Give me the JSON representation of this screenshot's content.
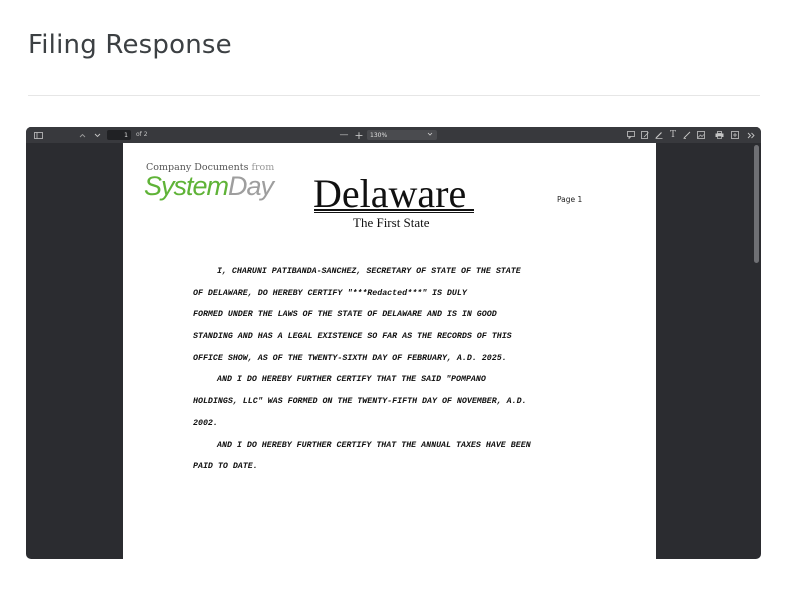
{
  "page": {
    "title": "Filing Response"
  },
  "viewer": {
    "toolbar": {
      "page_current": "1",
      "page_total_label": "of 2",
      "zoom_value": "130%",
      "zoom_minus": "—",
      "zoom_plus": "+",
      "icons": [
        "sidebar-toggle-icon",
        "chevron-up-icon",
        "chevron-down-icon",
        "comment-icon",
        "edit-icon",
        "highlight-icon",
        "text-icon",
        "draw-icon",
        "image-icon",
        "print-icon",
        "save-icon",
        "more-tools-icon"
      ]
    },
    "document": {
      "logo_line1": "Company Documents",
      "logo_line1_suffix": "from",
      "logo_system": "System",
      "logo_day": "Day",
      "state_name": "Delaware",
      "state_motto": "The First State",
      "page_label": "Page 1",
      "lines": [
        "I, CHARUNI PATIBANDA-SANCHEZ, SECRETARY OF STATE OF THE STATE",
        "OF DELAWARE, DO HEREBY CERTIFY \"***Redacted***\" IS DULY",
        "FORMED UNDER THE LAWS OF THE STATE OF DELAWARE AND IS IN GOOD",
        "STANDING AND HAS A LEGAL EXISTENCE SO FAR AS THE RECORDS OF THIS",
        "OFFICE SHOW, AS OF THE TWENTY-SIXTH DAY OF FEBRUARY, A.D. 2025.",
        "AND I DO HEREBY FURTHER CERTIFY THAT THE SAID \"POMPANO",
        "HOLDINGS, LLC\" WAS FORMED ON THE TWENTY-FIFTH DAY OF NOVEMBER, A.D.",
        "2002.",
        "AND I DO HEREBY FURTHER CERTIFY THAT THE ANNUAL TAXES HAVE BEEN",
        "PAID TO DATE."
      ]
    }
  },
  "colors": {
    "logo_green": "#5fb337",
    "logo_gray": "#9e9e9e",
    "viewer_bg": "#2b2c30",
    "toolbar_bg": "#38393d"
  }
}
